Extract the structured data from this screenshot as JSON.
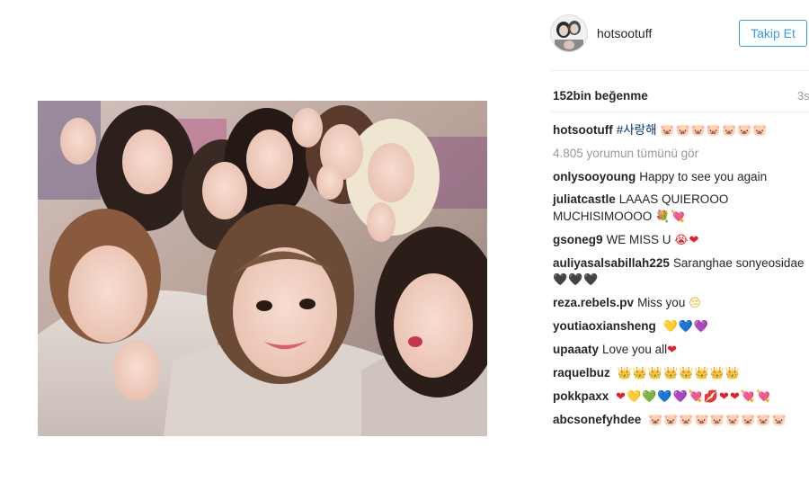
{
  "post": {
    "photo_alt": "group selfie photo",
    "username": "hotsootuff",
    "follow_label": "Takip Et",
    "likes": "152bin beğenme",
    "time": "3s",
    "view_all": "4.805 yorumun tümünü gör"
  },
  "comments": [
    {
      "user": "hotsootuff",
      "text": "",
      "hashtag": "#사랑해",
      "emoji": "🐷🐷🐷🐷🐷🐷🐷"
    },
    {
      "user": "onlysooyoung",
      "text": "Happy to see you again",
      "emoji": ""
    },
    {
      "user": "juliatcastle",
      "text": "LAAAS QUIEROOO MUCHISIMOOOO",
      "emoji": "💐💘"
    },
    {
      "user": "gsoneg9",
      "text": "WE MISS U",
      "emoji": "😭❤"
    },
    {
      "user": "auliyasalsabillah225",
      "text": "Saranghae sonyeosidae",
      "emoji": "🖤🖤🖤"
    },
    {
      "user": "reza.rebels.pv",
      "text": "Miss you",
      "emoji": "😔"
    },
    {
      "user": "youtiaoxiansheng",
      "text": "",
      "emoji": "💛💙💜"
    },
    {
      "user": "upaaaty",
      "text": "Love you all",
      "emoji": "❤"
    },
    {
      "user": "raquelbuz",
      "text": "",
      "emoji": "👑👑👑👑👑👑👑👑"
    },
    {
      "user": "pokkpaxx",
      "text": "",
      "emoji": "❤💛💚💙💜💘💋❤❤💘💘"
    },
    {
      "user": "abcsonefyhdee",
      "text": "",
      "emoji": "🐷🐷🐷🐷🐷🐷🐷🐷🐷"
    }
  ],
  "colors": {
    "link_blue": "#3897f0",
    "hashtag": "#003569",
    "muted": "#999999",
    "text": "#262626"
  }
}
